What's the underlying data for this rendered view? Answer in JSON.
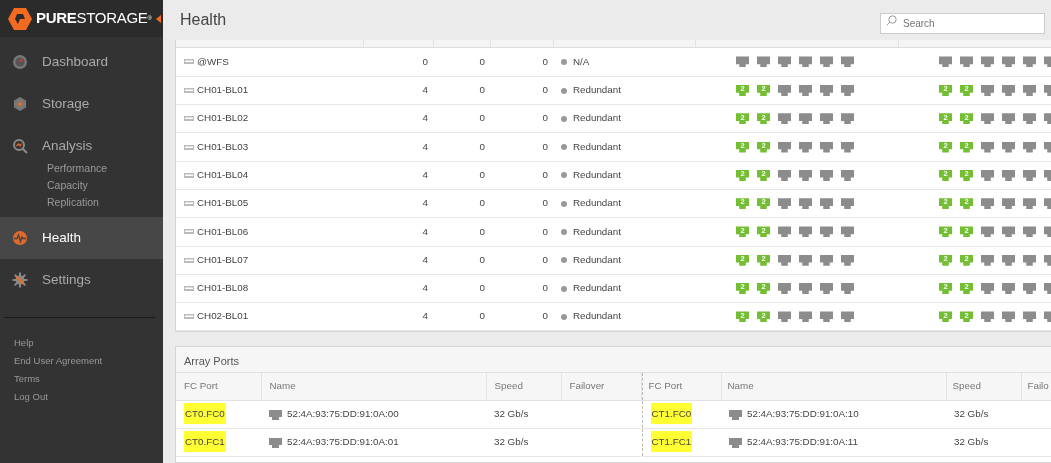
{
  "sidebar": {
    "logo": "**PURE**STORAGE$^{®}$",
    "items": [
      {
        "label": "Dashboard",
        "selected": false
      },
      {
        "label": "Storage",
        "selected": false
      },
      {
        "label": "Analysis",
        "selected": false,
        "children": [
          {
            "label": "Performance"
          },
          {
            "label": "Capacity"
          },
          {
            "label": "Replication"
          }
        ]
      },
      {
        "label": "Health",
        "selected": true
      },
      {
        "label": "Settings",
        "selected": false
      }
    ],
    "links": [
      "Help",
      "End User Agreement",
      "Terms",
      "Log Out"
    ]
  },
  "header": {
    "title": "Health",
    "search": {
      "placeholder": "Search"
    }
  },
  "hosts_table": {
    "rows": [
      {
        "name": "@WFS",
        "column_2": "0",
        "column_3": "0",
        "column_4": "0",
        "status": "N/A",
        "ports_group_1": [
          {
            "connected": false
          },
          {
            "connected": false
          },
          {
            "connected": false
          },
          {
            "connected": false
          },
          {
            "connected": false
          },
          {
            "connected": false
          }
        ],
        "ports_group_2": [
          {
            "connected": false
          },
          {
            "connected": false
          },
          {
            "connected": false
          },
          {
            "connected": false
          },
          {
            "connected": false
          },
          {
            "connected": false
          }
        ]
      },
      {
        "name": "CH01-BL01",
        "column_2": "4",
        "column_3": "0",
        "column_4": "0",
        "status": "Redundant",
        "ports_group_1": [
          {
            "connected": true,
            "label": "2"
          },
          {
            "connected": true,
            "label": "2"
          },
          {
            "connected": false
          },
          {
            "connected": false
          },
          {
            "connected": false
          },
          {
            "connected": false
          }
        ],
        "ports_group_2": [
          {
            "connected": true,
            "label": "2"
          },
          {
            "connected": true,
            "label": "2"
          },
          {
            "connected": false
          },
          {
            "connected": false
          },
          {
            "connected": false
          },
          {
            "connected": false
          }
        ]
      },
      {
        "name": "CH01-BL02",
        "column_2": "4",
        "column_3": "0",
        "column_4": "0",
        "status": "Redundant",
        "ports_group_1": [
          {
            "connected": true,
            "label": "2"
          },
          {
            "connected": true,
            "label": "2"
          },
          {
            "connected": false
          },
          {
            "connected": false
          },
          {
            "connected": false
          },
          {
            "connected": false
          }
        ],
        "ports_group_2": [
          {
            "connected": true,
            "label": "2"
          },
          {
            "connected": true,
            "label": "2"
          },
          {
            "connected": false
          },
          {
            "connected": false
          },
          {
            "connected": false
          },
          {
            "connected": false
          }
        ]
      },
      {
        "name": "CH01-BL03",
        "column_2": "4",
        "column_3": "0",
        "column_4": "0",
        "status": "Redundant",
        "ports_group_1": [
          {
            "connected": true,
            "label": "2"
          },
          {
            "connected": true,
            "label": "2"
          },
          {
            "connected": false
          },
          {
            "connected": false
          },
          {
            "connected": false
          },
          {
            "connected": false
          }
        ],
        "ports_group_2": [
          {
            "connected": true,
            "label": "2"
          },
          {
            "connected": true,
            "label": "2"
          },
          {
            "connected": false
          },
          {
            "connected": false
          },
          {
            "connected": false
          },
          {
            "connected": false
          }
        ]
      },
      {
        "name": "CH01-BL04",
        "column_2": "4",
        "column_3": "0",
        "column_4": "0",
        "status": "Redundant",
        "ports_group_1": [
          {
            "connected": true,
            "label": "2"
          },
          {
            "connected": true,
            "label": "2"
          },
          {
            "connected": false
          },
          {
            "connected": false
          },
          {
            "connected": false
          },
          {
            "connected": false
          }
        ],
        "ports_group_2": [
          {
            "connected": true,
            "label": "2"
          },
          {
            "connected": true,
            "label": "2"
          },
          {
            "connected": false
          },
          {
            "connected": false
          },
          {
            "connected": false
          },
          {
            "connected": false
          }
        ]
      },
      {
        "name": "CH01-BL05",
        "column_2": "4",
        "column_3": "0",
        "column_4": "0",
        "status": "Redundant",
        "ports_group_1": [
          {
            "connected": true,
            "label": "2"
          },
          {
            "connected": true,
            "label": "2"
          },
          {
            "connected": false
          },
          {
            "connected": false
          },
          {
            "connected": false
          },
          {
            "connected": false
          }
        ],
        "ports_group_2": [
          {
            "connected": true,
            "label": "2"
          },
          {
            "connected": true,
            "label": "2"
          },
          {
            "connected": false
          },
          {
            "connected": false
          },
          {
            "connected": false
          },
          {
            "connected": false
          }
        ]
      },
      {
        "name": "CH01-BL06",
        "column_2": "4",
        "column_3": "0",
        "column_4": "0",
        "status": "Redundant",
        "ports_group_1": [
          {
            "connected": true,
            "label": "2"
          },
          {
            "connected": true,
            "label": "2"
          },
          {
            "connected": false
          },
          {
            "connected": false
          },
          {
            "connected": false
          },
          {
            "connected": false
          }
        ],
        "ports_group_2": [
          {
            "connected": true,
            "label": "2"
          },
          {
            "connected": true,
            "label": "2"
          },
          {
            "connected": false
          },
          {
            "connected": false
          },
          {
            "connected": false
          },
          {
            "connected": false
          }
        ]
      },
      {
        "name": "CH01-BL07",
        "column_2": "4",
        "column_3": "0",
        "column_4": "0",
        "status": "Redundant",
        "ports_group_1": [
          {
            "connected": true,
            "label": "2"
          },
          {
            "connected": true,
            "label": "2"
          },
          {
            "connected": false
          },
          {
            "connected": false
          },
          {
            "connected": false
          },
          {
            "connected": false
          }
        ],
        "ports_group_2": [
          {
            "connected": true,
            "label": "2"
          },
          {
            "connected": true,
            "label": "2"
          },
          {
            "connected": false
          },
          {
            "connected": false
          },
          {
            "connected": false
          },
          {
            "connected": false
          }
        ]
      },
      {
        "name": "CH01-BL08",
        "column_2": "4",
        "column_3": "0",
        "column_4": "0",
        "status": "Redundant",
        "ports_group_1": [
          {
            "connected": true,
            "label": "2"
          },
          {
            "connected": true,
            "label": "2"
          },
          {
            "connected": false
          },
          {
            "connected": false
          },
          {
            "connected": false
          },
          {
            "connected": false
          }
        ],
        "ports_group_2": [
          {
            "connected": true,
            "label": "2"
          },
          {
            "connected": true,
            "label": "2"
          },
          {
            "connected": false
          },
          {
            "connected": false
          },
          {
            "connected": false
          },
          {
            "connected": false
          }
        ]
      },
      {
        "name": "CH02-BL01",
        "column_2": "4",
        "column_3": "0",
        "column_4": "0",
        "status": "Redundant",
        "ports_group_1": [
          {
            "connected": true,
            "label": "2"
          },
          {
            "connected": true,
            "label": "2"
          },
          {
            "connected": false
          },
          {
            "connected": false
          },
          {
            "connected": false
          },
          {
            "connected": false
          }
        ],
        "ports_group_2": [
          {
            "connected": true,
            "label": "2"
          },
          {
            "connected": true,
            "label": "2"
          },
          {
            "connected": false
          },
          {
            "connected": false
          },
          {
            "connected": false
          },
          {
            "connected": false
          }
        ]
      }
    ]
  },
  "array_ports": {
    "title": "Array Ports",
    "groups": [
      {
        "columns": [
          "FC Port",
          "Name",
          "Speed",
          "Failover"
        ],
        "rows": [
          {
            "port": "CT0.FC0",
            "name": "52:4A:93:75:DD:91:0A:00",
            "speed": "32 Gb/s",
            "highlighted": true
          },
          {
            "port": "CT0.FC1",
            "name": "52:4A:93:75:DD:91:0A:01",
            "speed": "32 Gb/s",
            "highlighted": true
          }
        ]
      },
      {
        "columns": [
          "FC Port",
          "Name",
          "Speed",
          "Failo"
        ],
        "rows": [
          {
            "port": "CT1.FC0",
            "name": "52:4A:93:75:DD:91:0A:10",
            "speed": "32 Gb/s",
            "highlighted": true
          },
          {
            "port": "CT1.FC1",
            "name": "52:4A:93:75:DD:91:0A:11",
            "speed": "32 Gb/s",
            "highlighted": true
          }
        ]
      }
    ]
  }
}
